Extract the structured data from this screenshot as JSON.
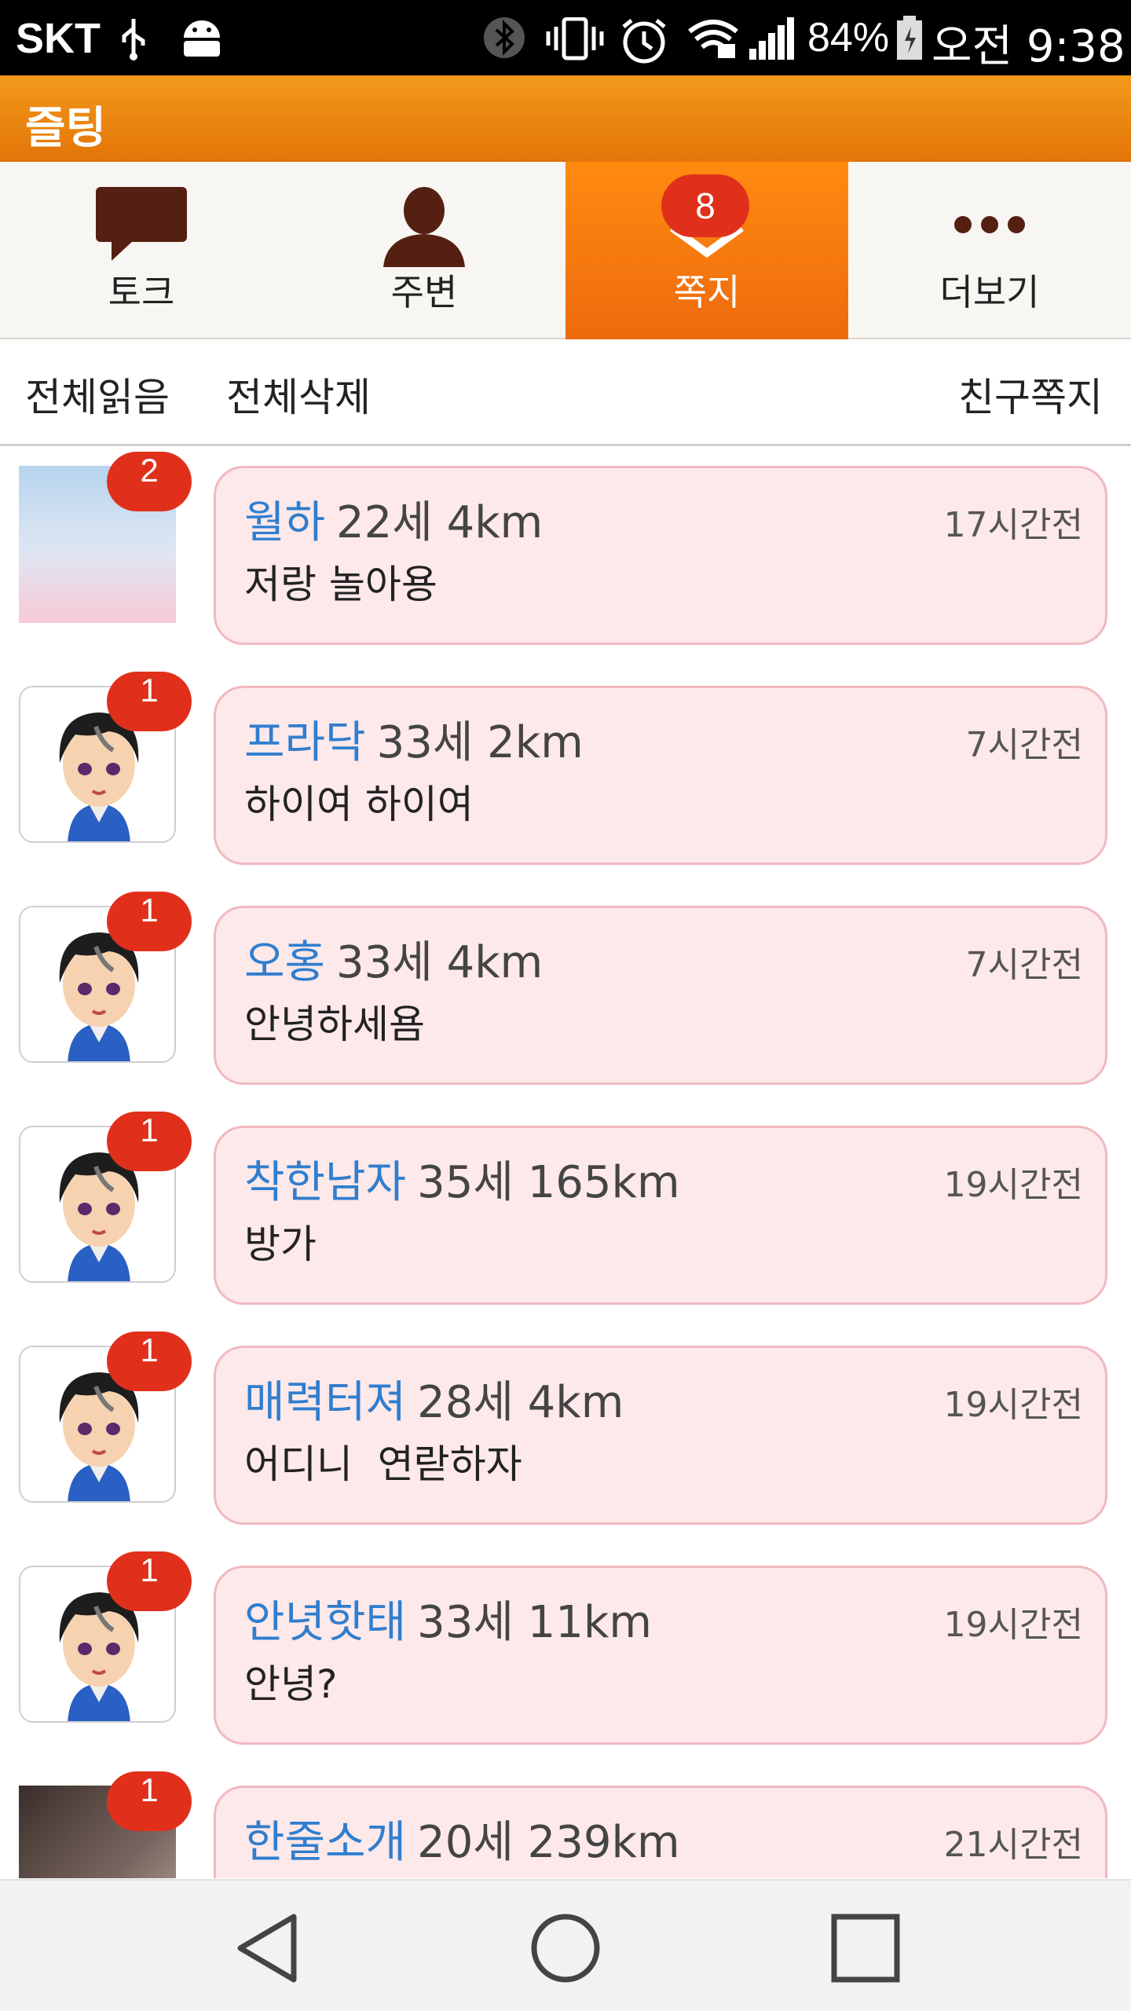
{
  "status_bar": {
    "carrier": "SKT",
    "battery_percent": "84%",
    "time": "오전 9:38",
    "icons": [
      "usb-icon",
      "android-icon",
      "bluetooth-icon",
      "vibrate-icon",
      "alarm-icon",
      "wifi-icon",
      "signal-icon",
      "battery-icon"
    ]
  },
  "app": {
    "title": "즐팅"
  },
  "tabs": [
    {
      "label": "토크",
      "icon": "chat-bubble-icon",
      "active": false
    },
    {
      "label": "주변",
      "icon": "person-icon",
      "active": false
    },
    {
      "label": "쪽지",
      "icon": "message-icon",
      "active": true,
      "badge": "8"
    },
    {
      "label": "더보기",
      "icon": "more-dots-icon",
      "active": false
    }
  ],
  "actions": {
    "read_all": "전체읽음",
    "delete_all": "전체삭제",
    "friend_messages": "친구쪽지"
  },
  "messages": [
    {
      "nick": "월하",
      "meta": "22세 4km",
      "time": "17시간전",
      "text": "저랑 놀아용",
      "count": "2",
      "avatar": "sky"
    },
    {
      "nick": "프라닥",
      "meta": "33세 2km",
      "time": "7시간전",
      "text": "하이여 하이여",
      "count": "1",
      "avatar": "cartoon"
    },
    {
      "nick": "오홍",
      "meta": "33세 4km",
      "time": "7시간전",
      "text": "안녕하세욤",
      "count": "1",
      "avatar": "cartoon"
    },
    {
      "nick": "착한남자",
      "meta": "35세 165km",
      "time": "19시간전",
      "text": "방가",
      "count": "1",
      "avatar": "cartoon"
    },
    {
      "nick": "매력터져",
      "meta": "28세 4km",
      "time": "19시간전",
      "text": "어디니  연랃하자",
      "count": "1",
      "avatar": "cartoon"
    },
    {
      "nick": "안녓핫태",
      "meta": "33세 11km",
      "time": "19시간전",
      "text": "안녕?",
      "count": "1",
      "avatar": "cartoon"
    },
    {
      "nick": "한줄소개",
      "meta": "20세 239km",
      "time": "21시간전",
      "text": "",
      "count": "1",
      "avatar": "photo"
    }
  ],
  "colors": {
    "accent": "#f08a12",
    "badge": "#e0301c",
    "nick": "#2f7ecf",
    "bubble": "#fde8ea"
  }
}
